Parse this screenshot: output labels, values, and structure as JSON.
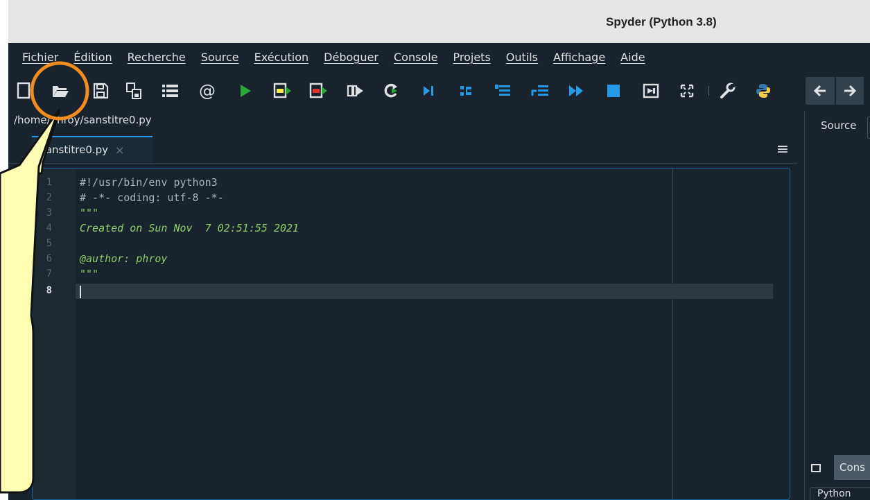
{
  "window": {
    "title": "Spyder (Python 3.8)"
  },
  "menu": [
    "Fichier",
    "Édition",
    "Recherche",
    "Source",
    "Exécution",
    "Déboguer",
    "Console",
    "Projets",
    "Outils",
    "Affichage",
    "Aide"
  ],
  "path": "/home/phroy/sanstitre0.py",
  "editor": {
    "tab_label": "sanstitre0.py",
    "tab_close": "×",
    "menu_glyph": "≡",
    "lines": [
      {
        "num": "1",
        "text": "#!/usr/bin/env python3"
      },
      {
        "num": "2",
        "text": "# -*- coding: utf-8 -*-"
      },
      {
        "num": "3",
        "text": "\"\"\""
      },
      {
        "num": "4",
        "text": "Created on Sun Nov  7 02:51:55 2021"
      },
      {
        "num": "5",
        "text": ""
      },
      {
        "num": "6",
        "text": "@author: phroy"
      },
      {
        "num": "7",
        "text": "\"\"\""
      },
      {
        "num": "8",
        "text": ""
      }
    ],
    "current_line": "8"
  },
  "right_panel": {
    "source_label": "Source",
    "console_tab": "Cons",
    "console_sub": "Python"
  },
  "colors": {
    "bg": "#19232d",
    "accent": "#259ae9",
    "run_green": "#2aa836",
    "highlight_orange": "#f28c1e",
    "callout_fill": "#ffffb3"
  },
  "icons": [
    "new-file-icon",
    "open-folder-icon",
    "save-icon",
    "save-all-icon",
    "list-icon",
    "at-icon",
    "run-icon",
    "run-cell-icon",
    "run-cell-advance-icon",
    "run-selection-icon",
    "rerun-icon",
    "debug-icon",
    "step-icon",
    "step-into-icon",
    "step-return-icon",
    "continue-icon",
    "stop-icon",
    "maximize-icon",
    "fullscreen-icon",
    "wrench-icon",
    "python-icon",
    "back-arrow-icon",
    "forward-arrow-icon"
  ]
}
